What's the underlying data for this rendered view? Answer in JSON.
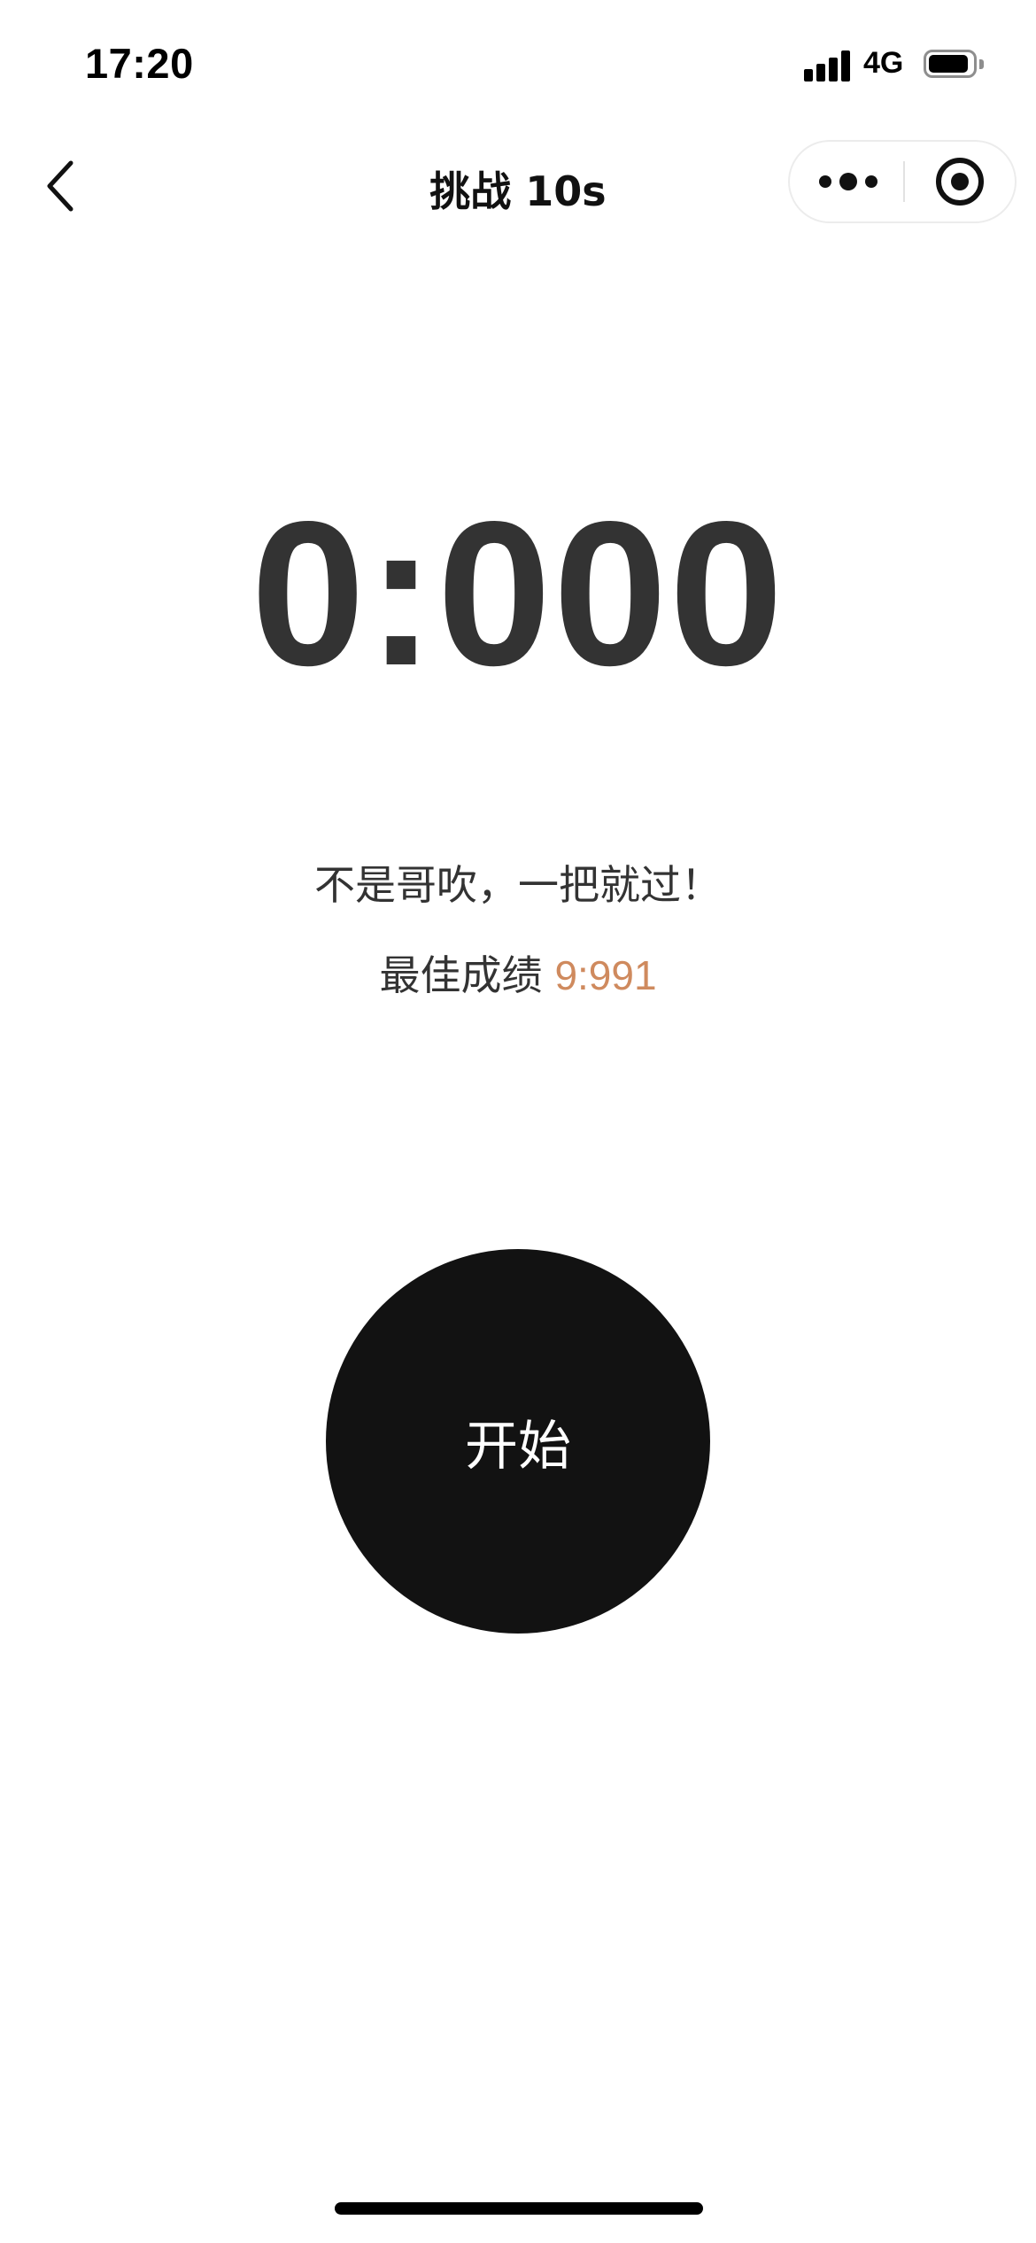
{
  "status_bar": {
    "time": "17:20",
    "network": "4G",
    "icons": [
      "signal-icon",
      "battery-icon"
    ]
  },
  "nav": {
    "title": "挑战 10s",
    "icons": [
      "back-chevron-icon",
      "more-dots-icon",
      "close-target-icon"
    ]
  },
  "main": {
    "timer": "0:000",
    "slogan": "不是哥吹，一把就过！",
    "best_label": "最佳成绩",
    "best_value": "9:991",
    "start_label": "开始"
  },
  "colors": {
    "background": "#ffffff",
    "timer_text": "#333333",
    "best_value": "#cf8a5e",
    "start_button": "#121212",
    "start_text": "#ffffff"
  }
}
